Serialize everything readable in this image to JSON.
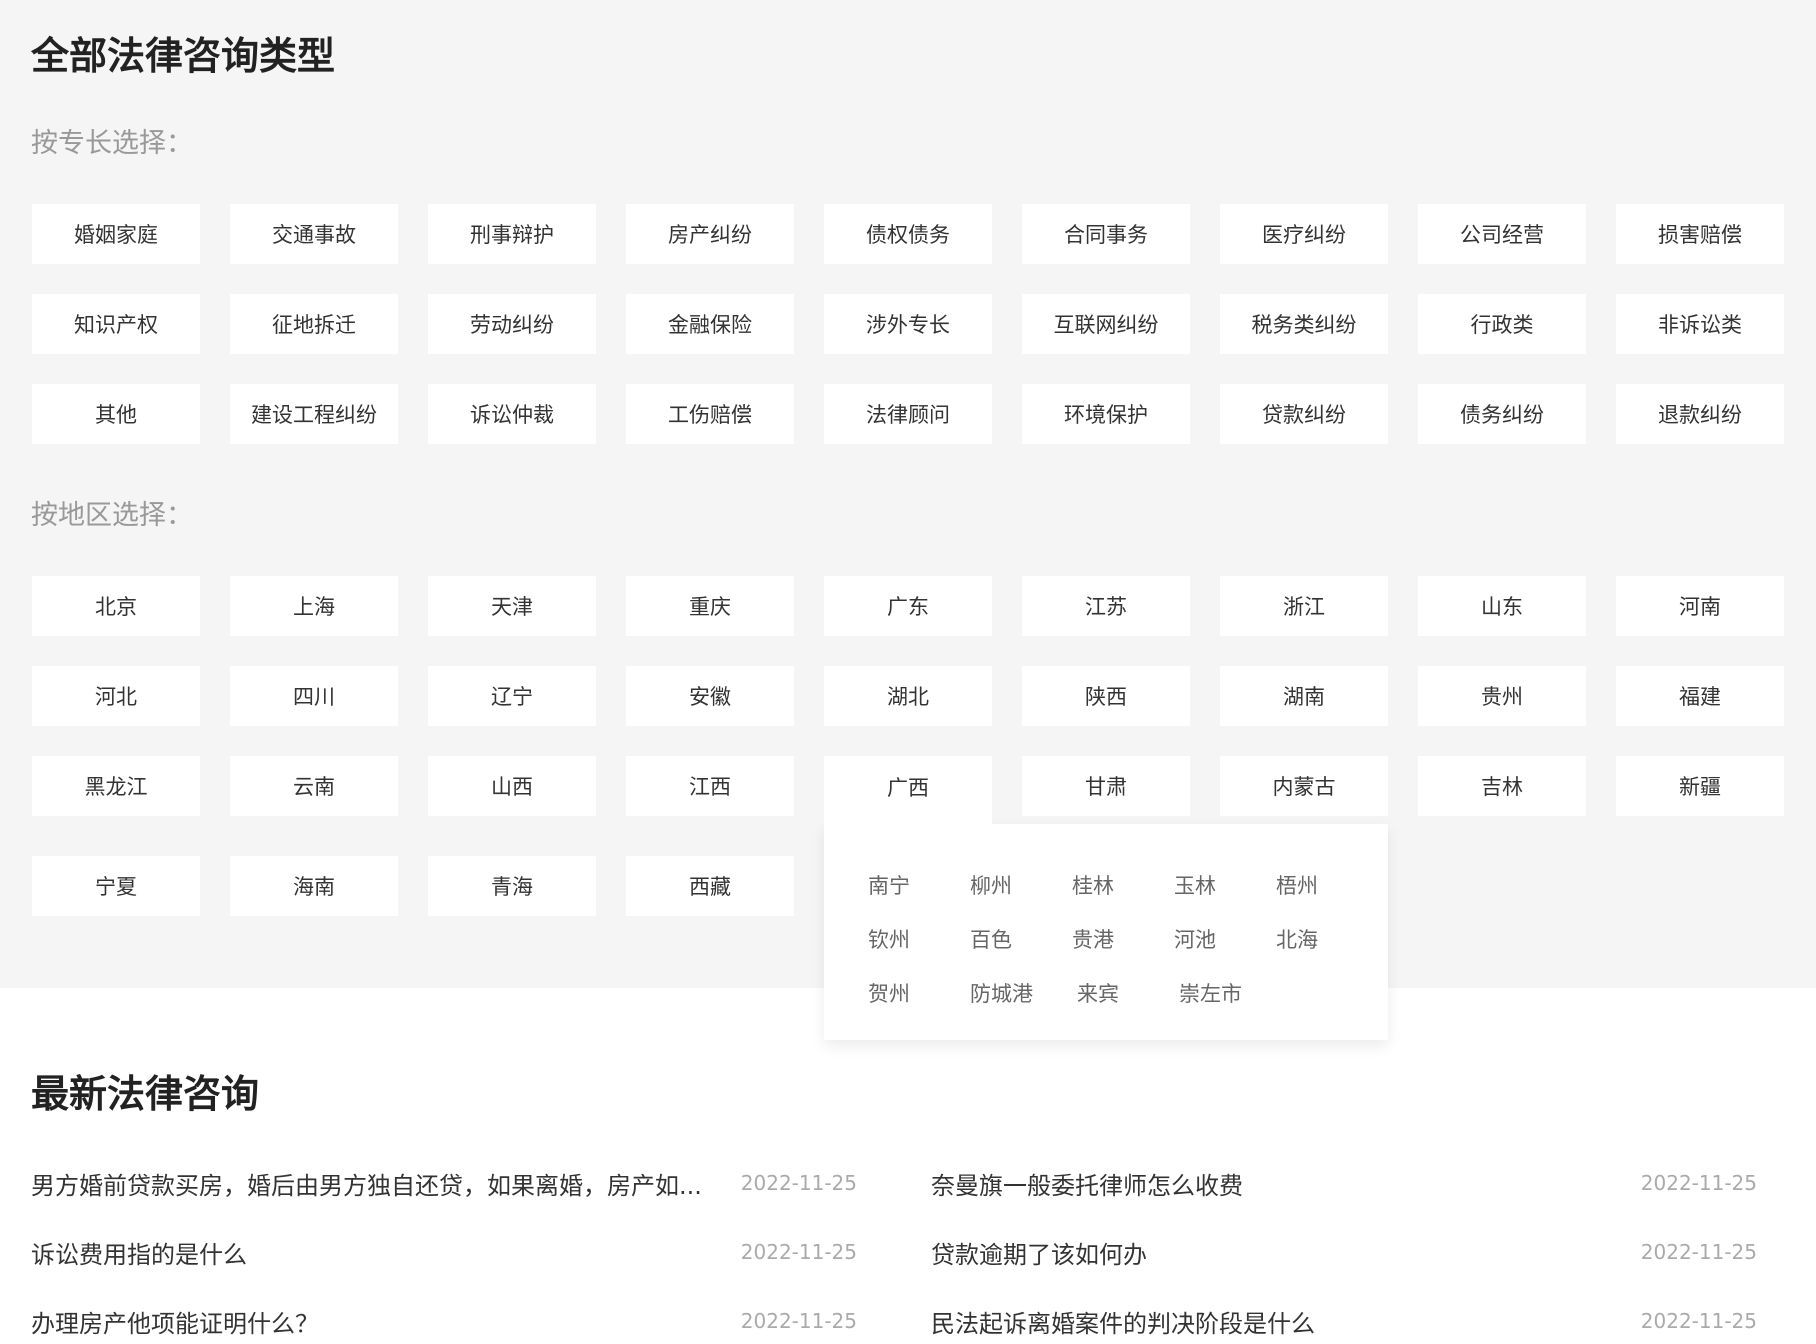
{
  "page_title": "全部法律咨询类型",
  "specialty": {
    "label": "按专长选择：",
    "items": [
      "婚姻家庭",
      "交通事故",
      "刑事辩护",
      "房产纠纷",
      "债权债务",
      "合同事务",
      "医疗纠纷",
      "公司经营",
      "损害赔偿",
      "知识产权",
      "征地拆迁",
      "劳动纠纷",
      "金融保险",
      "涉外专长",
      "互联网纠纷",
      "税务类纠纷",
      "行政类",
      "非诉讼类",
      "其他",
      "建设工程纠纷",
      "诉讼仲裁",
      "工伤赔偿",
      "法律顾问",
      "环境保护",
      "贷款纠纷",
      "债务纠纷",
      "退款纠纷"
    ]
  },
  "region": {
    "label": "按地区选择：",
    "items": [
      "北京",
      "上海",
      "天津",
      "重庆",
      "广东",
      "江苏",
      "浙江",
      "山东",
      "河南",
      "河北",
      "四川",
      "辽宁",
      "安徽",
      "湖北",
      "陕西",
      "湖南",
      "贵州",
      "福建",
      "黑龙江",
      "云南",
      "山西",
      "江西",
      "广西",
      "甘肃",
      "内蒙古",
      "吉林",
      "新疆",
      "宁夏",
      "海南",
      "青海",
      "西藏"
    ],
    "active": "广西",
    "popup_cities": [
      [
        "南宁",
        "柳州",
        "桂林",
        "玉林",
        "梧州"
      ],
      [
        "钦州",
        "百色",
        "贵港",
        "河池",
        "北海"
      ],
      [
        "贺州",
        "防城港",
        "来宾",
        "崇左市"
      ]
    ]
  },
  "consult": {
    "title": "最新法律咨询",
    "items": [
      {
        "q": "男方婚前贷款买房，婚后由男方独自还贷，如果离婚，房产如...",
        "date": "2022-11-25"
      },
      {
        "q": "奈曼旗一般委托律师怎么收费",
        "date": "2022-11-25"
      },
      {
        "q": "诉讼费用指的是什么",
        "date": "2022-11-25"
      },
      {
        "q": "贷款逾期了该如何办",
        "date": "2022-11-25"
      },
      {
        "q": "办理房产他项能证明什么？",
        "date": "2022-11-25"
      },
      {
        "q": "民法起诉离婚案件的判决阶段是什么",
        "date": "2022-11-25"
      }
    ]
  }
}
